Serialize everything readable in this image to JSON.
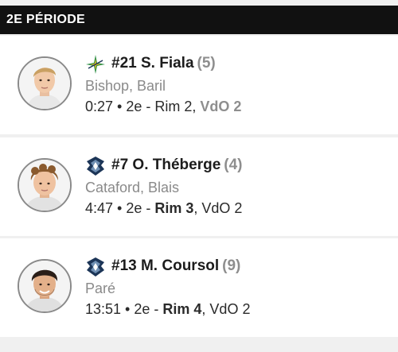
{
  "period": {
    "title": "2E PÉRIODE"
  },
  "goals": [
    {
      "team_logo": "armada-logo-icon",
      "scorer": "#21 S. Fiala",
      "goal_count": "(5)",
      "assists": "Bishop, Baril",
      "time_period": "0:27 • 2e - ",
      "home_score": "Rim 2",
      "separator": ", ",
      "away_score": "VdO 2",
      "highlight": "away"
    },
    {
      "team_logo": "oceanic-logo-icon",
      "scorer": "#7 O. Théberge",
      "goal_count": "(4)",
      "assists": "Cataford, Blais",
      "time_period": "4:47 • 2e - ",
      "home_score": "Rim 3",
      "separator": ", ",
      "away_score": "VdO 2",
      "highlight": "home"
    },
    {
      "team_logo": "oceanic-logo-icon",
      "scorer": "#13 M. Coursol",
      "goal_count": "(9)",
      "assists": "Paré",
      "time_period": "13:51 • 2e - ",
      "home_score": "Rim 4",
      "separator": ", ",
      "away_score": "VdO 2",
      "highlight": "home"
    }
  ],
  "colors": {
    "header_bg": "#111111",
    "oceanic_navy": "#1c3557",
    "armada_green": "#2f8f46",
    "armada_yellow": "#e8b820"
  }
}
